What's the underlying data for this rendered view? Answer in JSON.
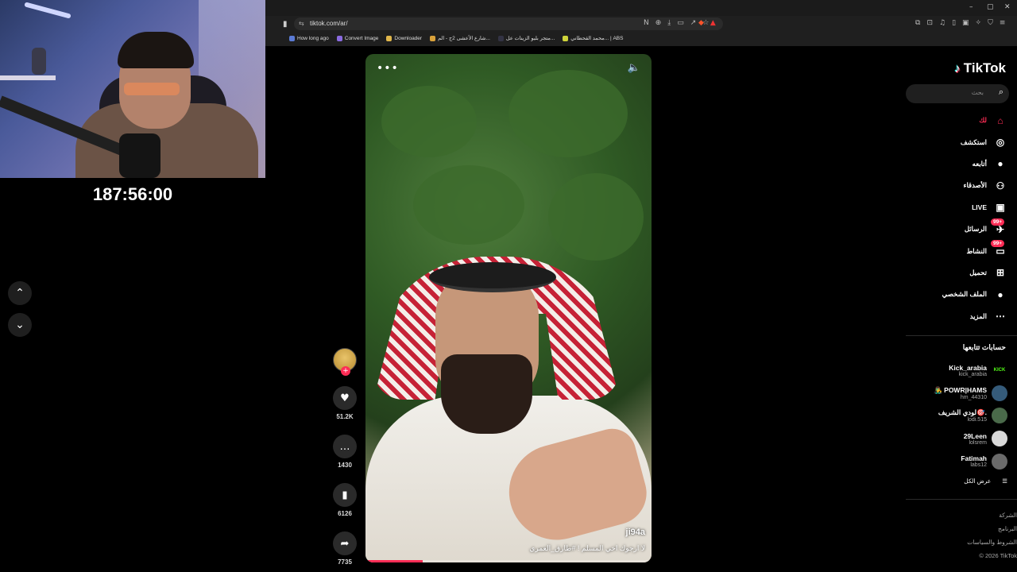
{
  "stream": {
    "timer": "187:56:00"
  },
  "browser": {
    "url": "tiktok.com/ar/",
    "bookmarks": [
      "How long ago",
      "Convert Image",
      "Downloader",
      "شارع الأعشى 2ج - الم...",
      "متجر بليو الزينات عل...",
      "محمد القحطاني... | ABS"
    ]
  },
  "video": {
    "author": "ji94a",
    "caption": "لا ارجوك اخي المسلم ! #طارق_العمري",
    "progress_fraction": 0.2
  },
  "actions": {
    "likes": "51.2K",
    "comments": "1430",
    "saves": "6126",
    "shares": "7735"
  },
  "sidebar": {
    "logo": "TikTok",
    "search_placeholder": "بحث",
    "menu": [
      {
        "label": "لك",
        "icon": "home-icon",
        "glyph": "⌂",
        "active": true,
        "badge": ""
      },
      {
        "label": "استكشف",
        "icon": "compass-icon",
        "glyph": "◎",
        "active": false,
        "badge": ""
      },
      {
        "label": "أتابعه",
        "icon": "following-avatar-icon",
        "glyph": "●",
        "active": false,
        "badge": ""
      },
      {
        "label": "الأصدقاء",
        "icon": "friends-icon",
        "glyph": "⚇",
        "active": false,
        "badge": ""
      },
      {
        "label": "LIVE",
        "icon": "live-icon",
        "glyph": "▣",
        "active": false,
        "badge": ""
      },
      {
        "label": "الرسائل",
        "icon": "messages-icon",
        "glyph": "✈",
        "active": false,
        "badge": "99+"
      },
      {
        "label": "النشاط",
        "icon": "activity-icon",
        "glyph": "▭",
        "active": false,
        "badge": "99+"
      },
      {
        "label": "تحميل",
        "icon": "upload-icon",
        "glyph": "⊞",
        "active": false,
        "badge": ""
      },
      {
        "label": "الملف الشخصي",
        "icon": "profile-avatar-icon",
        "glyph": "●",
        "active": false,
        "badge": ""
      },
      {
        "label": "المزيد",
        "icon": "more-icon",
        "glyph": "⋯",
        "active": false,
        "badge": ""
      }
    ],
    "following_title": "حسابات تتابعها",
    "following": [
      {
        "name": "Kick_arabia",
        "handle": "kick_arabia",
        "avatar_color": "#000000",
        "kick": "KICK"
      },
      {
        "name": "👨‍🎤 POWR|HAMS",
        "handle": "hm_44310",
        "avatar_color": "#355b7a",
        "kick": ""
      },
      {
        "name": "لودي الشريف🎯.",
        "handle": "lodi.515",
        "avatar_color": "#4a6a4a",
        "kick": ""
      },
      {
        "name": "29Leen",
        "handle": "lolsrem",
        "avatar_color": "#d8d8d8",
        "kick": ""
      },
      {
        "name": "Fatimah",
        "handle": "labs12",
        "avatar_color": "#6a6a6a",
        "kick": ""
      }
    ],
    "see_all": "عرض الكل",
    "footer": [
      "الشركة",
      "البرنامج",
      "الشروط والسياسات",
      "© 2026 TikTok"
    ]
  }
}
